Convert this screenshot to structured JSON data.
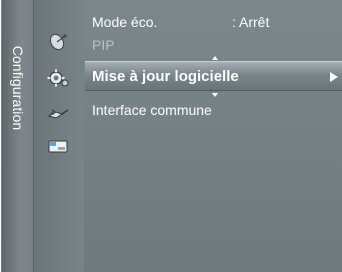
{
  "side_tab": {
    "label": "Configuration"
  },
  "icons": {
    "satellite": "satellite-dish-icon",
    "setup": "gear-icon",
    "plug": "plug-icon",
    "card": "common-interface-card-icon"
  },
  "menu": {
    "items": [
      {
        "label": "Mode éco.",
        "value": ": Arrêt",
        "state": "normal"
      },
      {
        "label": "PIP",
        "value": "",
        "state": "disabled"
      },
      {
        "label": "Mise à jour logicielle",
        "value": "",
        "state": "selected"
      },
      {
        "label": "Interface commune",
        "value": "",
        "state": "normal"
      }
    ]
  },
  "colors": {
    "background": "#737d81",
    "highlight": "#8d979b",
    "text": "#ffffff",
    "disabled_text": "#b9c1c4"
  }
}
